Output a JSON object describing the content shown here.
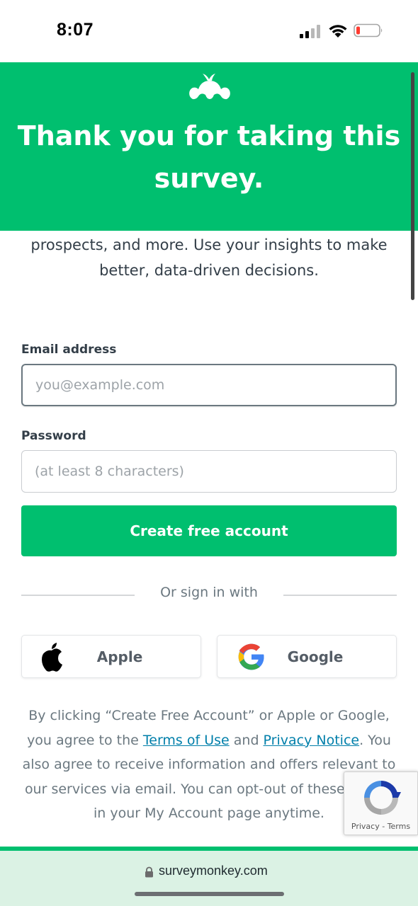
{
  "status_bar": {
    "time": "8:07",
    "icons": [
      "cellular-signal-icon",
      "wifi-icon",
      "battery-low-icon"
    ],
    "battery_color": "#ff3b30"
  },
  "hero": {
    "logo": "surveymonkey-logo-icon",
    "title": "Thank you for taking this survey.",
    "background_color": "#00bf6f"
  },
  "intro_text": "prospects, and more. Use your insights to make better, data-driven decisions.",
  "form": {
    "email": {
      "label": "Email address",
      "placeholder": "you@example.com",
      "value": ""
    },
    "password": {
      "label": "Password",
      "placeholder": "(at least 8 characters)",
      "value": ""
    },
    "create_button": "Create free account",
    "divider_text": "Or sign in with",
    "social": {
      "apple": {
        "label": "Apple",
        "icon": "apple-icon"
      },
      "google": {
        "label": "Google",
        "icon": "google-icon"
      }
    }
  },
  "legal": {
    "part1": "By clicking “Create Free Account” or Apple or Google, you agree to the ",
    "terms_link": "Terms of Use",
    "part2": " and ",
    "privacy_link": "Privacy Notice",
    "part3": ". You also agree to receive information and offers relevant to our services via email. You can opt-out of these emails in your My Account page anytime."
  },
  "recaptcha": {
    "privacy": "Privacy",
    "separator": " - ",
    "terms": "Terms"
  },
  "browser": {
    "url": "surveymonkey.com",
    "icon": "lock-icon"
  },
  "colors": {
    "brand_green": "#00bf6f",
    "link": "#007faa",
    "url_bar_bg": "#dbf2e4"
  }
}
